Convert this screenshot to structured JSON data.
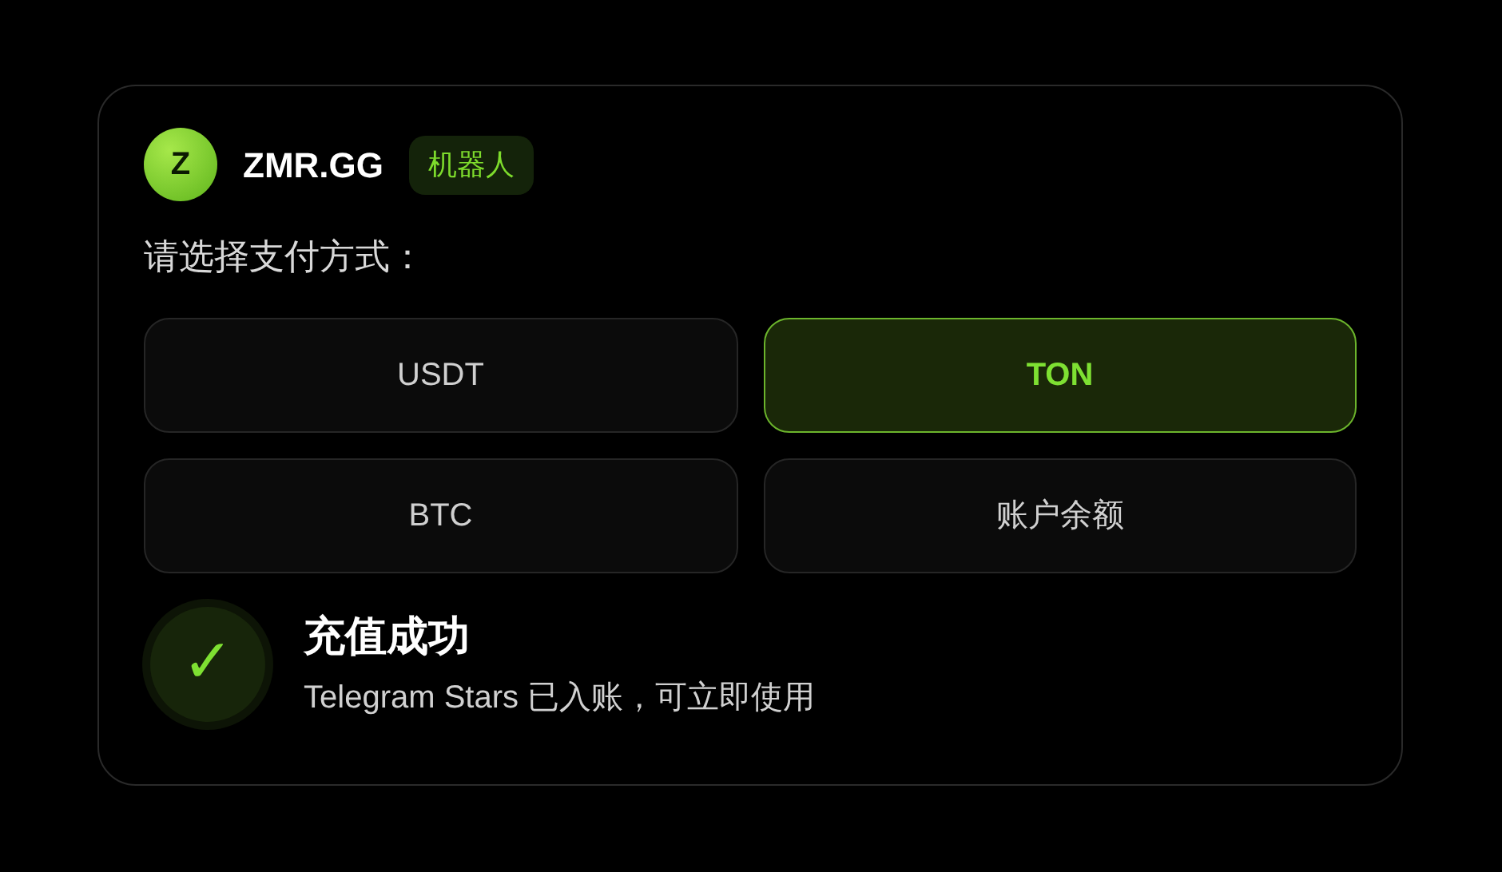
{
  "header": {
    "avatar": "Z",
    "name": "ZMR.GG",
    "tag": "机器人"
  },
  "prompt": "请选择支付方式：",
  "options": [
    {
      "label": "USDT",
      "selected": false
    },
    {
      "label": "TON",
      "selected": true
    },
    {
      "label": "BTC",
      "selected": false
    },
    {
      "label": "账户余额",
      "selected": false
    }
  ],
  "status": {
    "icon": "✓",
    "title": "充值成功",
    "message": "Telegram Stars 已入账，可立即使用"
  }
}
